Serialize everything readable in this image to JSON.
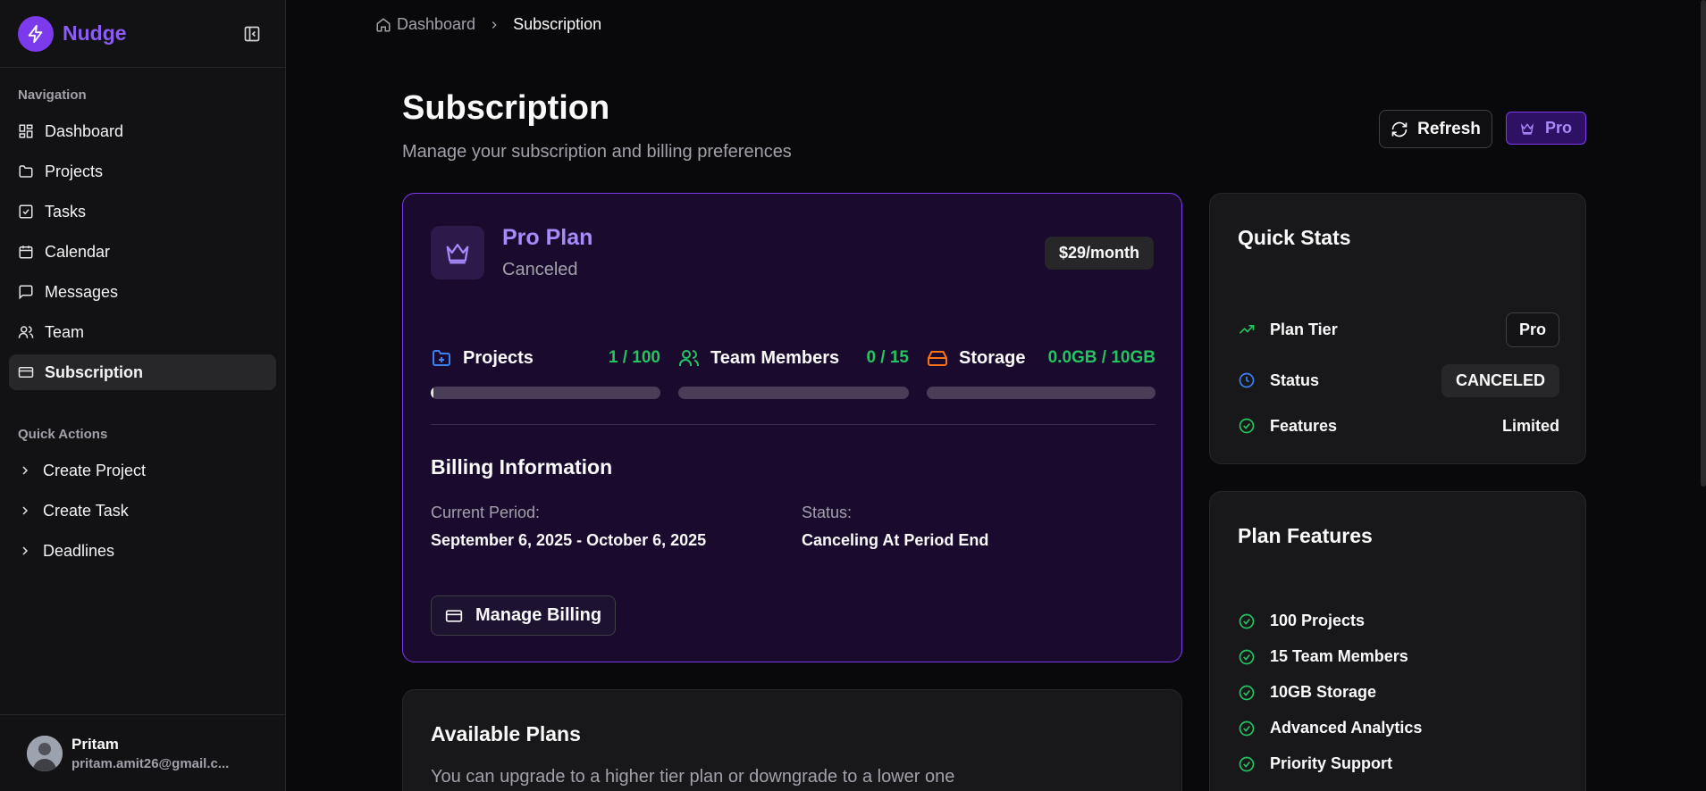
{
  "app": {
    "name": "Nudge"
  },
  "sidebar": {
    "nav_label": "Navigation",
    "items": [
      {
        "label": "Dashboard",
        "icon": "dashboard-icon"
      },
      {
        "label": "Projects",
        "icon": "folder-icon"
      },
      {
        "label": "Tasks",
        "icon": "checkbox-icon"
      },
      {
        "label": "Calendar",
        "icon": "calendar-icon"
      },
      {
        "label": "Messages",
        "icon": "message-icon"
      },
      {
        "label": "Team",
        "icon": "users-icon"
      },
      {
        "label": "Subscription",
        "icon": "credit-card-icon",
        "active": true
      }
    ],
    "quick_actions_label": "Quick Actions",
    "quick_actions": [
      {
        "label": "Create Project"
      },
      {
        "label": "Create Task"
      },
      {
        "label": "Deadlines"
      }
    ],
    "user": {
      "name": "Pritam",
      "email": "pritam.amit26@gmail.c..."
    }
  },
  "breadcrumb": {
    "home": "Dashboard",
    "current": "Subscription"
  },
  "header": {
    "title": "Subscription",
    "subtitle": "Manage your subscription and billing preferences",
    "refresh_label": "Refresh",
    "plan_badge": "Pro"
  },
  "plan": {
    "name": "Pro Plan",
    "status": "Canceled",
    "price": "$29/month",
    "usage": [
      {
        "label": "Projects",
        "value": "1 / 100",
        "fraction": 0.01,
        "icon": "folder-plus-icon",
        "color": "#3b82f6"
      },
      {
        "label": "Team Members",
        "value": "0 / 15",
        "fraction": 0,
        "icon": "users-icon",
        "color": "#22c55e"
      },
      {
        "label": "Storage",
        "value": "0.0GB / 10GB",
        "fraction": 0,
        "icon": "hard-drive-icon",
        "color": "#f97316"
      }
    ],
    "billing": {
      "title": "Billing Information",
      "period_label": "Current Period:",
      "period_value": "September 6, 2025 - October 6, 2025",
      "status_label": "Status:",
      "status_value": "Canceling At Period End"
    },
    "manage_label": "Manage Billing"
  },
  "available_plans": {
    "title": "Available Plans",
    "description": "You can upgrade to a higher tier plan or downgrade to a lower one"
  },
  "quick_stats": {
    "title": "Quick Stats",
    "rows": [
      {
        "label": "Plan Tier",
        "value": "Pro",
        "icon": "trending-up-icon"
      },
      {
        "label": "Status",
        "value": "CANCELED",
        "icon": "clock-icon"
      },
      {
        "label": "Features",
        "value": "Limited",
        "icon": "check-circle-icon"
      }
    ]
  },
  "plan_features": {
    "title": "Plan Features",
    "items": [
      "100 Projects",
      "15 Team Members",
      "10GB Storage",
      "Advanced Analytics",
      "Priority Support"
    ]
  },
  "colors": {
    "accent": "#7c3aed",
    "accent_text": "#a78bfa",
    "success": "#22c55e",
    "info": "#3b82f6",
    "warning": "#f97316"
  }
}
